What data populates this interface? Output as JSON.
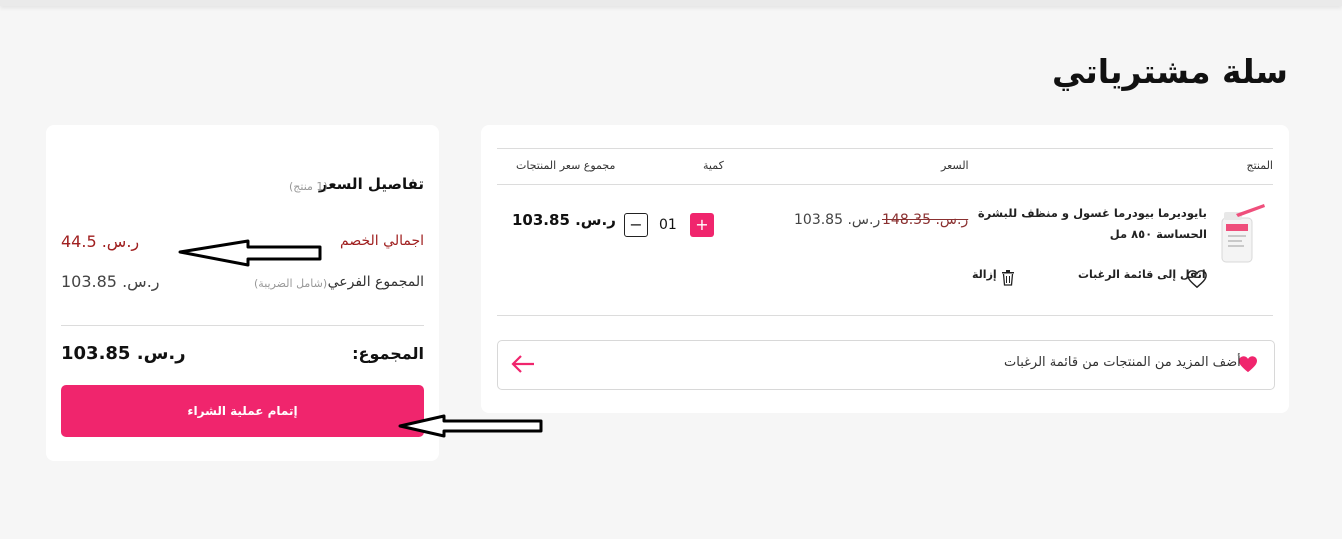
{
  "page": {
    "title": "سلة مشترياتي"
  },
  "cart": {
    "headers": {
      "product": "المنتج",
      "price": "السعر",
      "quantity": "كمية",
      "line_total": "مجموع سعر المنتجات"
    },
    "item": {
      "name": "بايوديرما بيودرما غسول و منظف للبشرة الحساسة ٨٥٠ مل",
      "old_price": "ر.س. 148.35",
      "price": "ر.س. 103.85",
      "quantity": "01",
      "plus": "+",
      "minus": "−",
      "line_total": "ر.س. 103.85",
      "move_to_wishlist": "انقل إلى قائمة الرغبات",
      "remove": "إزالة"
    },
    "add_more": "أضف المزيد من المنتجات من قائمة الرغبات"
  },
  "summary": {
    "title": "تفاصيل السعر",
    "count": "(1 منتج)",
    "discount_label": "اجمالي الخصم",
    "discount_value": "ر.س. 44.5",
    "subtotal_label": "المجموع الفرعي",
    "subtotal_note": "(شامل الضريبة)",
    "subtotal_value": "ر.س. 103.85",
    "total_label": "المجموع:",
    "total_value": "ر.س. 103.85",
    "checkout": "إتمام عملية الشراء"
  },
  "colors": {
    "accent": "#f0256d",
    "discount": "#a02020",
    "background": "#f6f6f6"
  }
}
